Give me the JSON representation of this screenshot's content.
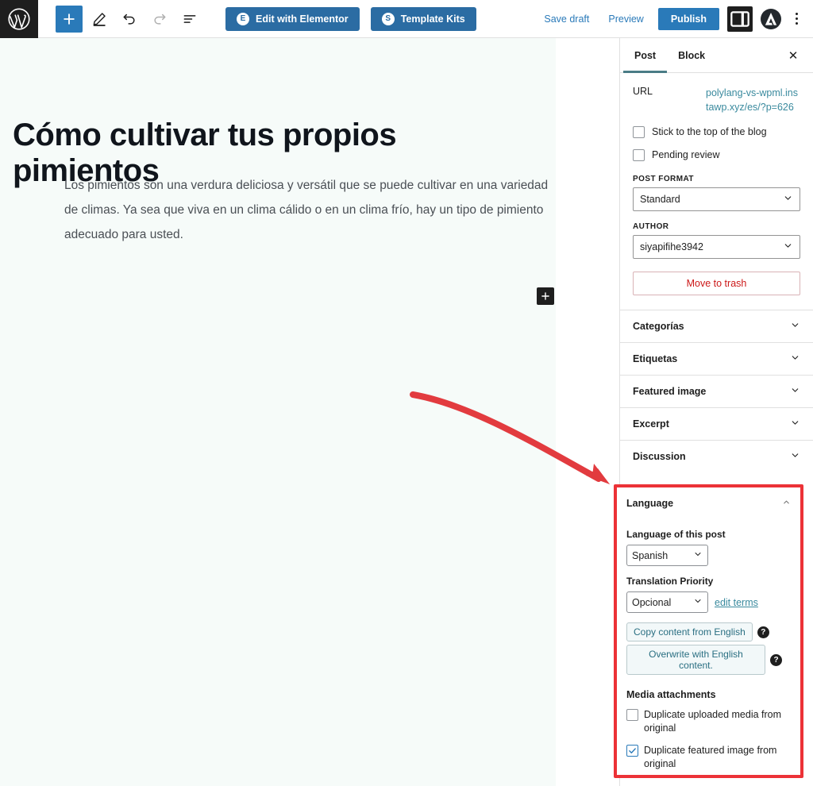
{
  "toolbar": {
    "logo_icon": "wordpress-logo-icon",
    "add_block_label": "+",
    "add_block_icon": "plus-icon",
    "edit_icon": "pencil-icon",
    "undo_icon": "undo-icon",
    "redo_icon": "redo-icon",
    "list_view_icon": "list-view-icon",
    "elementor_label": "Edit with Elementor",
    "elementor_badge": "E",
    "kits_label": "Template Kits",
    "kits_badge": "S",
    "save_draft_label": "Save draft",
    "preview_label": "Preview",
    "publish_label": "Publish",
    "settings_icon": "sidebar-panel-icon",
    "astra_icon": "astra-logo-icon",
    "astra_glyph": "▲",
    "options_icon": "kebab-menu-icon"
  },
  "editor": {
    "title": "Cómo cultivar tus propios pimientos",
    "paragraph": "Los pimientos son una verdura deliciosa y versátil que se puede cultivar en una variedad de climas. Ya sea que viva en un clima cálido o en un clima frío, hay un tipo de pimiento adecuado para usted.",
    "inserter_icon": "plus-icon"
  },
  "annotation": {
    "arrow_icon": "curved-arrow-icon",
    "arrow_color": "#e23b3f",
    "highlight_color": "#ec3237"
  },
  "sidebar": {
    "tabs": [
      {
        "label": "Post",
        "active": true
      },
      {
        "label": "Block",
        "active": false
      }
    ],
    "close_icon": "close-icon",
    "close_glyph": "✕",
    "url": {
      "label": "URL",
      "value": "polylang-vs-wpml.instawp.xyz/es/?p=626"
    },
    "checkboxes": [
      {
        "label": "Stick to the top of the blog",
        "checked": false
      },
      {
        "label": "Pending review",
        "checked": false
      }
    ],
    "post_format": {
      "label": "POST FORMAT",
      "value": "Standard"
    },
    "author": {
      "label": "AUTHOR",
      "value": "siyapifihe3942"
    },
    "trash_label": "Move to trash",
    "panels": [
      {
        "label": "Categorías",
        "expanded": false
      },
      {
        "label": "Etiquetas",
        "expanded": false
      },
      {
        "label": "Featured image",
        "expanded": false
      },
      {
        "label": "Excerpt",
        "expanded": false
      },
      {
        "label": "Discussion",
        "expanded": false
      }
    ],
    "chevron_icon": "chevron-down-icon"
  },
  "language_panel": {
    "title": "Language",
    "collapse_icon": "chevron-up-icon",
    "post_language_label": "Language of this post",
    "post_language_value": "Spanish",
    "translation_priority_label": "Translation Priority",
    "translation_priority_value": "Opcional",
    "edit_terms_label": "edit terms",
    "copy_content_label": "Copy content from English",
    "overwrite_label": "Overwrite with English content.",
    "help_glyph": "?",
    "media_title": "Media attachments",
    "media_checkboxes": [
      {
        "label": "Duplicate uploaded media from original",
        "checked": false
      },
      {
        "label": "Duplicate featured image from original",
        "checked": true
      }
    ]
  }
}
